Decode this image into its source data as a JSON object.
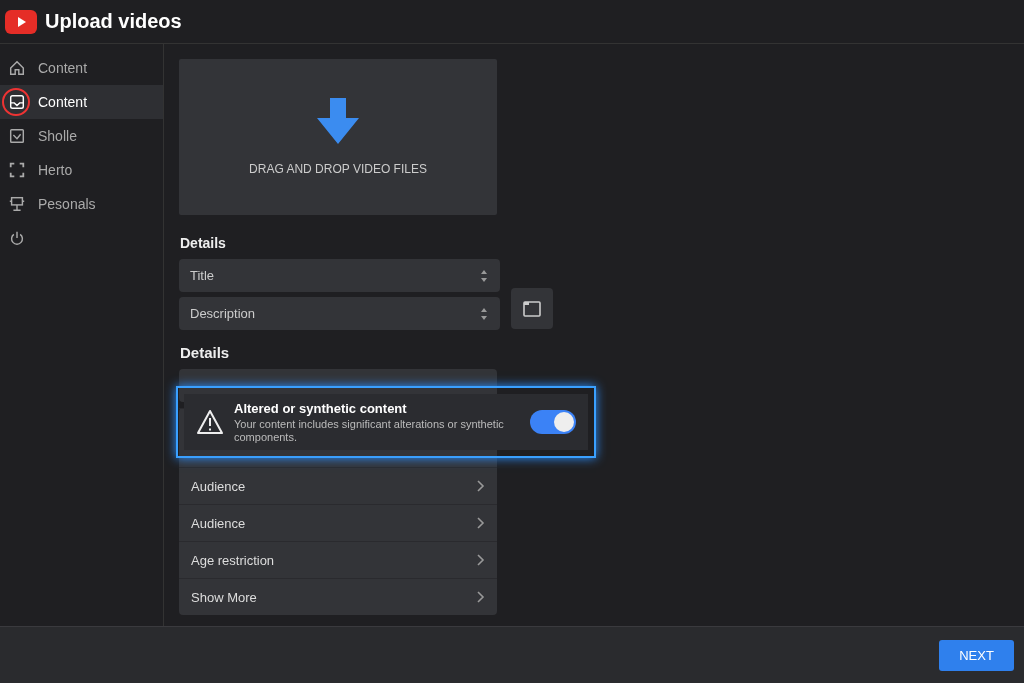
{
  "window": {
    "title": "Upload videos"
  },
  "sidebar": {
    "items": [
      {
        "label": "Content",
        "selected": false,
        "circled": false
      },
      {
        "label": "Content",
        "selected": true,
        "circled": true
      },
      {
        "label": "Sholle",
        "selected": false,
        "circled": false
      },
      {
        "label": "Herto",
        "selected": false,
        "circled": false
      },
      {
        "label": "Pesonals",
        "selected": false,
        "circled": false
      },
      {
        "selected": false,
        "circled": false
      }
    ]
  },
  "upload": {
    "label": "DRAG AND DROP VIDEO FILES"
  },
  "details": {
    "heading": "Details",
    "fields": [
      {
        "label": "Title"
      },
      {
        "label": "Description"
      }
    ]
  },
  "details_2": {
    "heading": "Details",
    "rows": [
      {
        "label": "Audience"
      },
      {
        "label": "Audience"
      },
      {
        "label": "Age restriction"
      },
      {
        "label": "Show More"
      }
    ]
  },
  "notice": {
    "title": "Altered or synthetic content",
    "text": "Your content includes significant alterations or synthetic components.",
    "on": true
  },
  "footer": {
    "button": "NEXT"
  }
}
